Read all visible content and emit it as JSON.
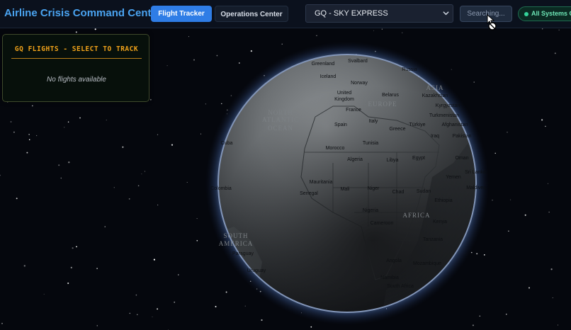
{
  "header": {
    "app_title": "Airline Crisis Command Center",
    "tabs": [
      {
        "label": "Flight Tracker",
        "active": true
      },
      {
        "label": "Operations Center",
        "active": false
      }
    ],
    "airline_select": {
      "value": "GQ - SKY EXPRESS"
    },
    "search_button": {
      "label": "Searching...",
      "disabled": true
    },
    "status": {
      "label": "All Systems Op",
      "color": "#34d399"
    }
  },
  "flights_panel": {
    "title": "GQ FLIGHTS - SELECT TO TRACK",
    "empty_message": "No flights available",
    "accent_color": "#f0a21a"
  },
  "globe": {
    "countries": [
      "Greenland",
      "Svalbard",
      "Russia",
      "Iceland",
      "Norway",
      "United",
      "Kingdom",
      "Belarus",
      "Kazakhstan",
      "Kyrgyzstan",
      "France",
      "Turkmenistan",
      "Afghanistan",
      "Spain",
      "Italy",
      "Greece",
      "Türkiye",
      "Iraq",
      "Pakistan",
      "Cuba",
      "Morocco",
      "Tunisia",
      "Libya",
      "Egypt",
      "Algeria",
      "Oman",
      "Sri Lanka",
      "Yemen",
      "Colombia",
      "Mauritania",
      "Mali",
      "Niger",
      "Chad",
      "Sudan",
      "Maldives",
      "Senegal",
      "Ethiopia",
      "Nigeria",
      "Cameroon",
      "Kenya",
      "Tanzania",
      "Paraguay",
      "Angola",
      "Mozambique",
      "Uruguay",
      "Namibia",
      "South Africa"
    ],
    "regions": [
      "EUROPE",
      "ASIA",
      "NORTH",
      "ATLANTIC",
      "OCEAN",
      "AFRICA",
      "SOUTH",
      "AMERICA"
    ]
  }
}
